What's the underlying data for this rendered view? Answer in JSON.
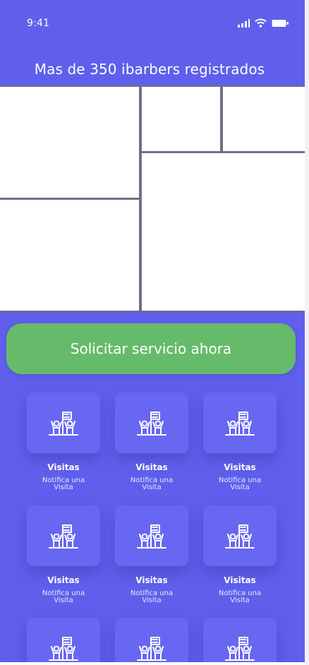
{
  "status_bar": {
    "time": "9:41",
    "icons": [
      "signal-icon",
      "wifi-icon",
      "battery-icon"
    ]
  },
  "header": {
    "title": "Mas de 350 ibarbers registrados"
  },
  "cta": {
    "label": "Solicitar servicio ahora",
    "color": "#66bb6a"
  },
  "services": [
    {
      "title": "Visitas",
      "subtitle": "Notifica una\nVisita",
      "icon": "team-flag-icon"
    },
    {
      "title": "Visitas",
      "subtitle": "Notifica una\nVisita",
      "icon": "team-flag-icon"
    },
    {
      "title": "Visitas",
      "subtitle": "Notifica una\nVisita",
      "icon": "team-flag-icon"
    },
    {
      "title": "Visitas",
      "subtitle": "Notifica una\nVisita",
      "icon": "team-flag-icon"
    },
    {
      "title": "Visitas",
      "subtitle": "Notifica una\nVisita",
      "icon": "team-flag-icon"
    },
    {
      "title": "Visitas",
      "subtitle": "Notifica una\nVisita",
      "icon": "team-flag-icon"
    },
    {
      "title": "",
      "subtitle": "",
      "icon": "team-flag-icon"
    },
    {
      "title": "",
      "subtitle": "",
      "icon": "team-flag-icon"
    },
    {
      "title": "",
      "subtitle": "",
      "icon": "team-flag-icon"
    }
  ],
  "colors": {
    "background": "#5f5fec",
    "card": "#6767f2",
    "text": "#ffffff"
  }
}
